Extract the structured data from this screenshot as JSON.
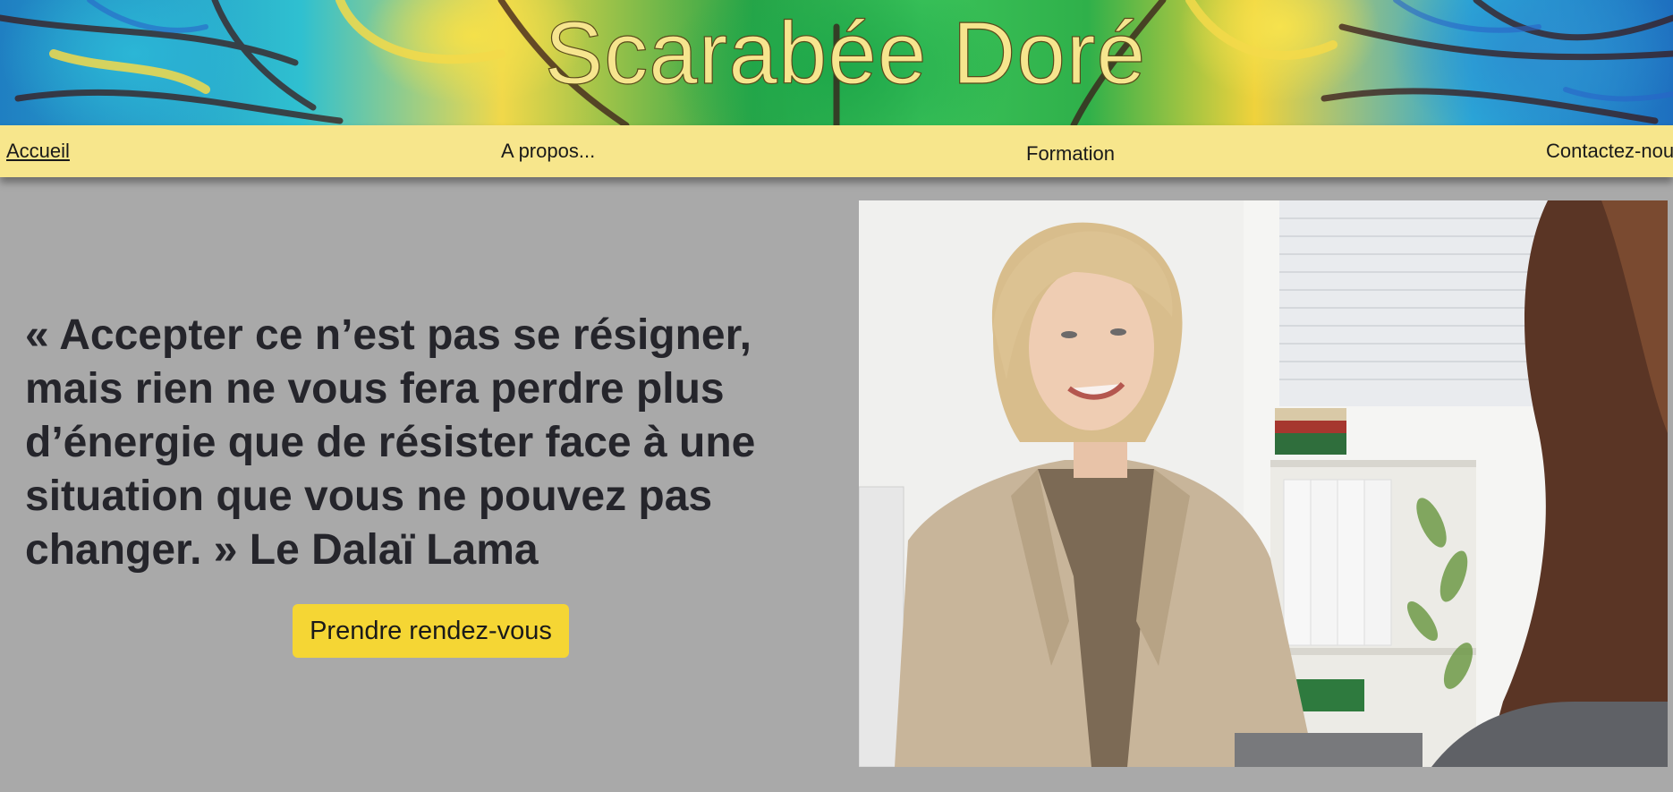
{
  "header": {
    "title": "Scarabée Doré"
  },
  "nav": {
    "items": [
      {
        "label": "Accueil",
        "active": true
      },
      {
        "label": "A propos..."
      },
      {
        "label": "Formation"
      },
      {
        "label": "Contactez-nous"
      }
    ]
  },
  "main": {
    "quote": "« Accepter ce n’est pas se résigner, mais rien ne vous fera perdre plus d’énergie que de résister face à une situation que vous ne pouvez pas changer. » Le Dalaï Lama",
    "cta_label": "Prendre rendez-vous"
  },
  "colors": {
    "background": "#a9a9a9",
    "nav_background": "#f7e68c",
    "cta_background": "#f5d634",
    "quote_text": "#25252b"
  }
}
